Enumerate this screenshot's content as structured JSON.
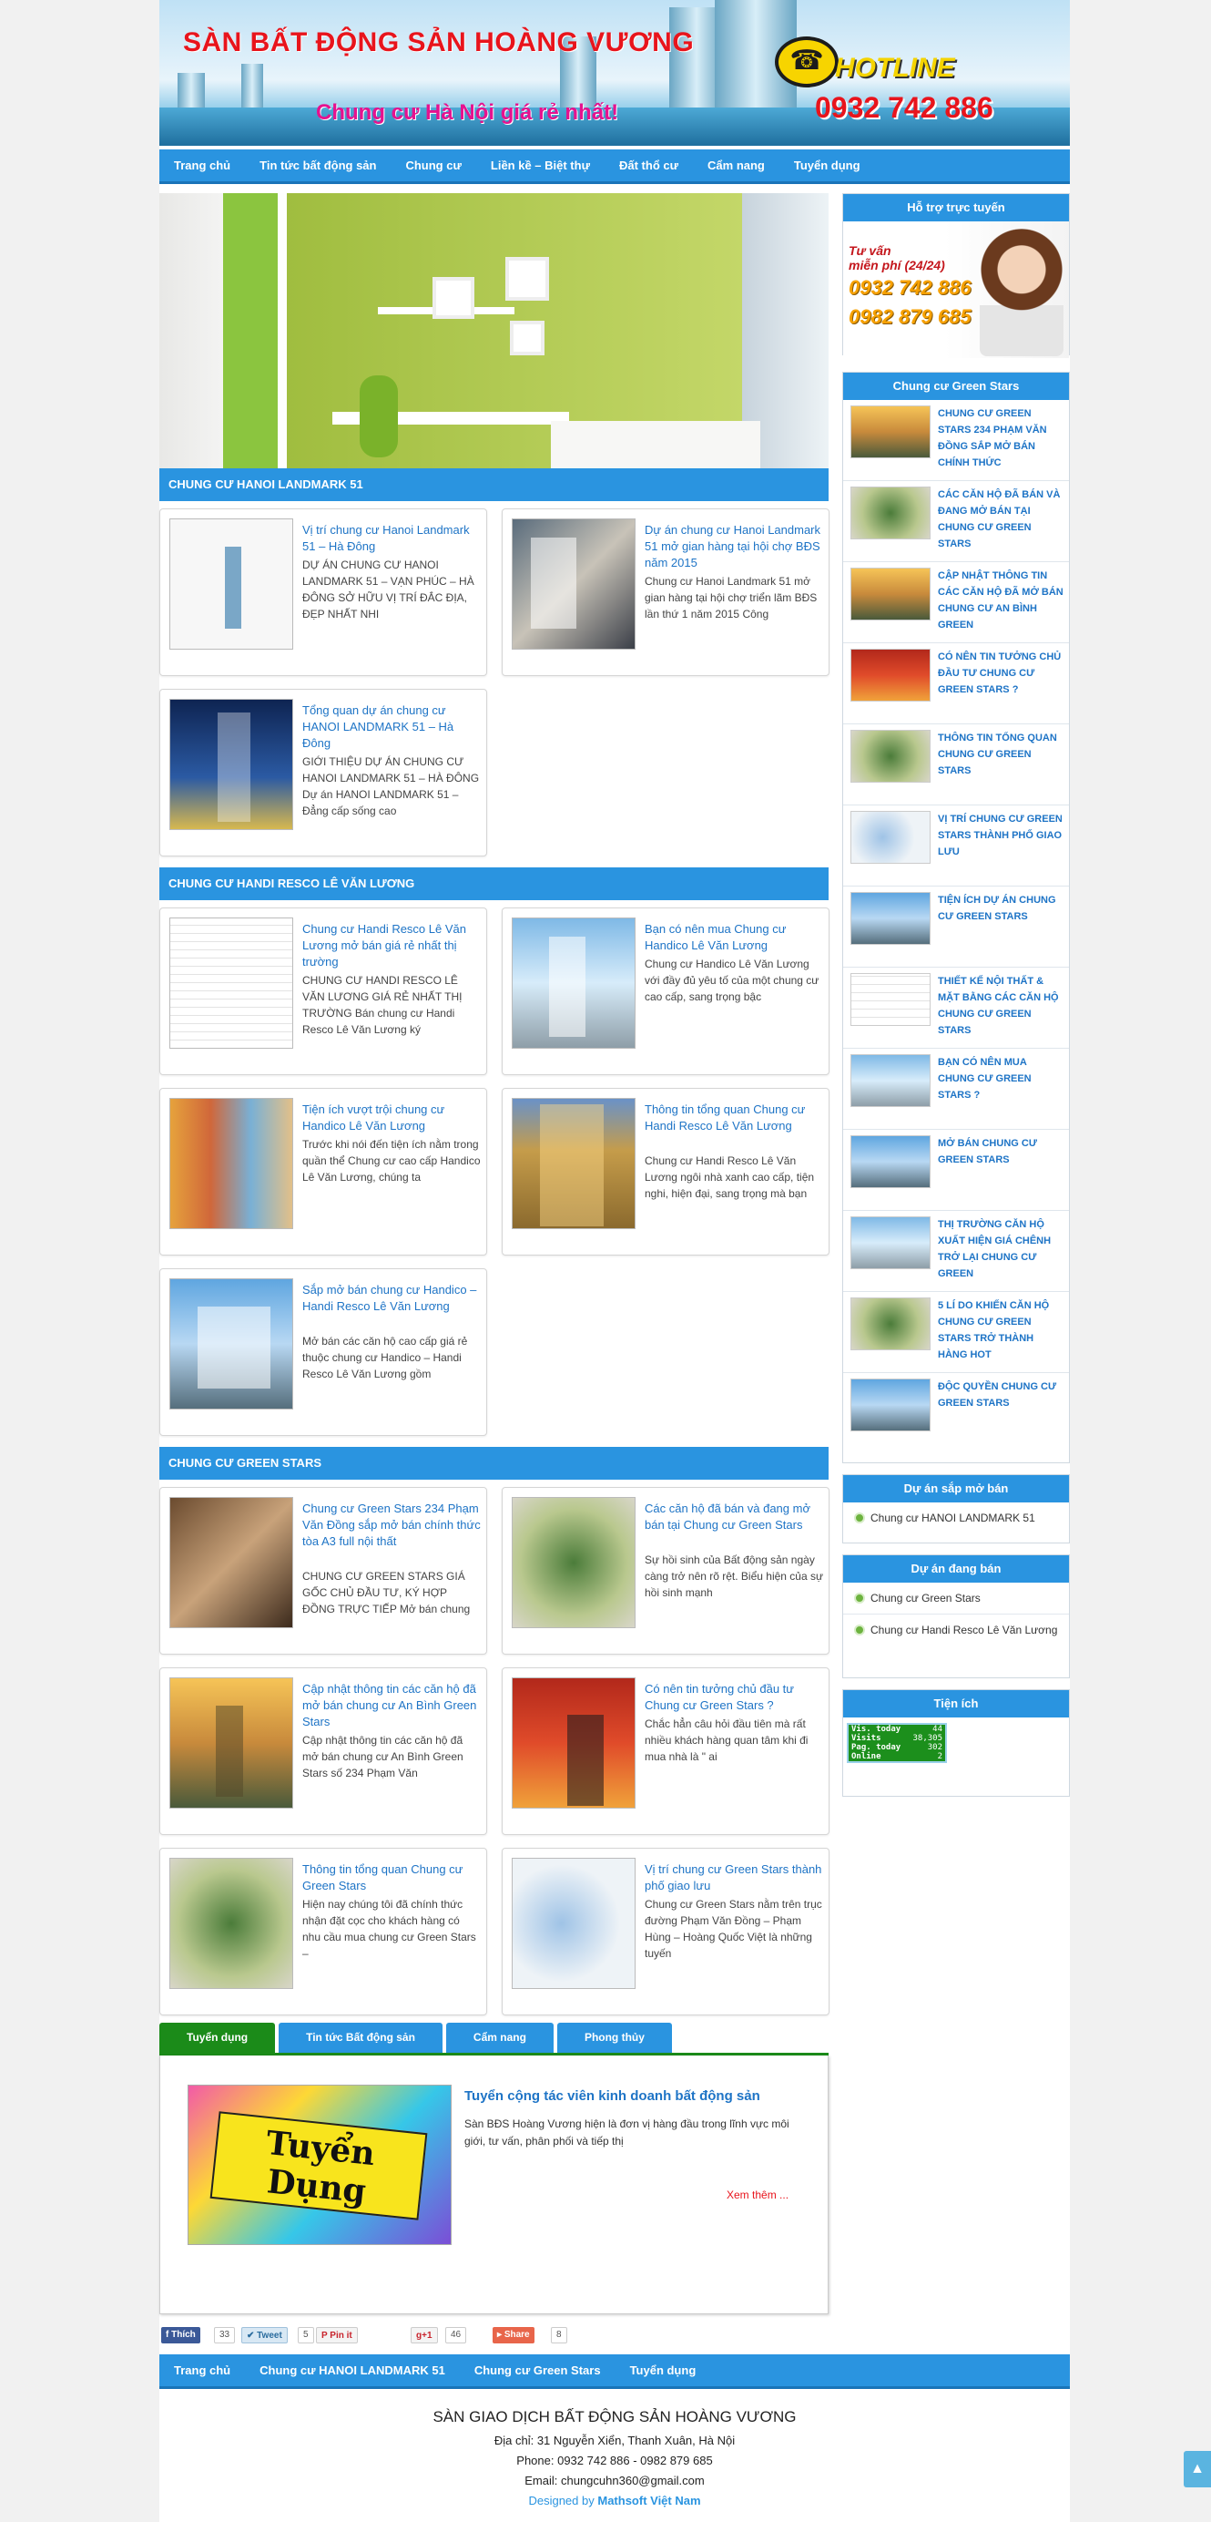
{
  "banner": {
    "site_title": "SÀN BẤT ĐỘNG SẢN HOÀNG VƯƠNG",
    "slogan": "Chung cư Hà Nội giá rẻ nhất!",
    "hotline_label": "HOTLINE",
    "hotline_number": "0932 742 886"
  },
  "top_nav": [
    "Trang chủ",
    "Tin tức bất động sản",
    "Chung cư",
    "Liền kề – Biệt thự",
    "Đất thổ cư",
    "Cẩm nang",
    "Tuyển dụng"
  ],
  "sections": [
    {
      "title": "CHUNG CƯ HANOI LANDMARK 51",
      "posts": [
        {
          "title": "Vị trí chung cư Hanoi Landmark 51 – Hà Đông",
          "desc": "DỰ ÁN CHUNG CƯ HANOI LANDMARK 51 – VẠN PHÚC – HÀ ĐÔNG SỞ HỮU VỊ TRÍ ĐẮC ĐỊA, ĐẸP NHẤT NHI",
          "thumb": "t-map"
        },
        {
          "title": "Dự án chung cư Hanoi Landmark 51 mở gian hàng tại hội chợ BĐS năm 2015",
          "desc": "Chung cư Hanoi Landmark 51 mở gian hàng tại hội chợ triển lãm BĐS lần thứ 1 năm 2015 Công",
          "thumb": "t-expo"
        },
        {
          "title": "Tổng quan dự án chung cư HANOI LANDMARK 51 – Hà Đông",
          "desc": "GIỚI THIỆU DỰ ÁN CHUNG CƯ HANOI LANDMARK 51 – HÀ ĐÔNG Dự án HANOI LANDMARK 51 – Đẳng cấp sống cao",
          "thumb": "t-tower"
        }
      ]
    },
    {
      "title": "CHUNG CƯ HANDI RESCO LÊ VĂN LƯƠNG",
      "posts": [
        {
          "title": "Chung cư Handi Resco Lê Văn Lương mở bán giá rẻ nhất thị trường",
          "desc": "CHUNG CƯ HANDI RESCO LÊ VĂN LƯƠNG GIÁ RẺ NHẤT THỊ TRƯỜNG Bán chung cư Handi Resco Lê Văn Lương ký",
          "thumb": "t-plan"
        },
        {
          "title": "Bạn có nên mua Chung cư Handico Lê Văn Lương",
          "desc": "Chung cư Handico Lê Văn Lương với đầy đủ yêu tố của một chung cư cao cấp, sang trọng bậc",
          "thumb": "t-sky"
        },
        {
          "title": "Tiện ích vượt trội chung cư Handico Lê Văn Lương",
          "desc": "Trước khi nói đến tiện ích nằm trong quần thể Chung cư cao cấp Handico Lê Văn Lương, chúng ta",
          "thumb": "t-collage"
        },
        {
          "title": "Thông tin tổng quan Chung cư Handi Resco Lê Văn Lương",
          "desc": "Chung cư Handi Resco Lê Văn Lương ngôi nhà xanh cao cấp, tiện nghi, hiện đại, sang trọng mà bạn",
          "thumb": "t-gold"
        },
        {
          "title": "Sắp mở bán chung cư Handico – Handi Resco Lê Văn Lương",
          "desc": "Mở bán các căn hộ cao cấp giá rẻ thuộc chung cư Handico – Handi Resco Lê Văn Lương gồm",
          "thumb": "t-render"
        }
      ]
    },
    {
      "title": "CHUNG CƯ GREEN STARS",
      "posts": [
        {
          "title": "Chung cư Green Stars 234 Phạm Văn Đồng sắp mở bán chính thức tòa A3 full nội thất",
          "desc": "CHUNG CƯ GREEN STARS GIÁ GỐC CHỦ ĐẦU TƯ, KÝ HỢP ĐỒNG TRỰC TIẾP Mở bán chung cư Green Stars trong",
          "thumb": "t-room"
        },
        {
          "title": "Các căn hộ đã bán và đang mở bán tại Chung cư Green Stars",
          "desc": "Sự hồi sinh của Bất động sản ngày càng trở nên rõ rệt. Biểu hiện của sự hồi sinh mạnh",
          "thumb": "t-aerial"
        },
        {
          "title": "Cập nhật thông tin các căn hộ đã mở bán chung cư An Bình Green Stars",
          "desc": "Cập nhật thông tin các căn hộ đã mở bán chung cư An Bình Green Stars số 234 Phạm Văn",
          "thumb": "t-sunset"
        },
        {
          "title": "Có nên tin tưởng chủ đầu tư Chung cư Green Stars ?",
          "desc": "Chắc hẳn câu hỏi đầu tiên mà rất nhiều khách hàng quan tâm khi đi mua nhà là \" ai",
          "thumb": "t-speech"
        },
        {
          "title": "Thông tin tổng quan Chung cư Green Stars",
          "desc": " Hiện nay chúng tôi đã chính thức nhận đặt cọc cho khách hàng có nhu cầu mua chung cư Green Stars –",
          "thumb": "t-aerial"
        },
        {
          "title": "Vị trí chung cư Green Stars thành phố giao lưu",
          "desc": "Chung cư Green Stars nằm trên trục đường Phạm Văn Đồng – Phạm Hùng – Hoàng Quốc Việt là những tuyến",
          "thumb": "t-map2"
        }
      ]
    }
  ],
  "tabs": [
    "Tuyển dụng",
    "Tin tức Bất động sản",
    "Cẩm nang",
    "Phong thủy"
  ],
  "tab_content": {
    "image_text": "Tuyển Dụng",
    "title": "Tuyển cộng tác viên kinh doanh bất động sản",
    "desc": "Sàn BĐS Hoàng Vương hiện là đơn vị hàng đầu trong lĩnh vực môi giới, tư vấn, phân phối và tiếp thị",
    "more": "Xem thêm ..."
  },
  "share": {
    "like": "Thích",
    "like_count": "33",
    "tweet": "Tweet",
    "tweet_count": "5",
    "pin": "Pin it",
    "gplus": "+1",
    "gplus_count": "46",
    "share": "Share",
    "share_count": "8"
  },
  "bottom_nav": [
    "Trang chủ",
    "Chung cư HANOI LANDMARK 51",
    "Chung cư Green Stars",
    "Tuyển dụng"
  ],
  "footer": {
    "name": "SÀN GIAO DỊCH BẤT ĐỘNG SẢN HOÀNG VƯƠNG",
    "address": "Địa chỉ: 31 Nguyễn Xiển, Thanh Xuân, Hà Nội",
    "phone": "Phone: 0932 742 886 - 0982 879 685",
    "email": "Email: chungcuhn360@gmail.com",
    "designed_by": "Designed by",
    "designer": "Mathsoft Việt Nam"
  },
  "sidebar": {
    "support": {
      "title": "Hỗ trợ trực tuyến",
      "line1": "Tư vấn",
      "line2": "miễn phí (24/24)",
      "phone1": "0932 742 886",
      "phone2": "0982 879 685"
    },
    "green_stars": {
      "title": "Chung cư Green Stars",
      "items": [
        "Chung cư Green Stars 234 Phạm Văn Đồng sắp mở bán chính thức",
        "Các căn hộ đã bán và đang mở bán tại Chung cư Green Stars",
        "Cập nhật thông tin các căn hộ đã mở bán chung cư An Bình Green",
        "Có nên tin tưởng chủ đầu tư Chung cư Green Stars ?",
        "Thông tin tổng quan Chung cư Green Stars",
        "Vị trí chung cư Green Stars thành phố giao lưu",
        "Tiện ích dự án chung cư Green Stars",
        "Thiết kế nội thất & mặt bằng các căn hộ chung cư Green Stars",
        "Bạn có nên mua chung cư Green Stars ?",
        "Mở bán chung cư Green Stars",
        "Thị trường căn hộ xuất hiện giá chênh trở lại chung cư Green",
        "5 lí do khiến căn hộ chung cư Green Stars trở thành hàng hot",
        "Độc quyền chung cư Green Stars"
      ]
    },
    "upcoming": {
      "title": "Dự án sắp mở bán",
      "items": [
        "Chung cư HANOI LANDMARK 51"
      ]
    },
    "selling": {
      "title": "Dự án đang bán",
      "items": [
        "Chung cư Green Stars",
        "Chung cư Handi Resco Lê Văn Lương"
      ]
    },
    "utility": {
      "title": "Tiện ích",
      "counter": [
        {
          "label": "Vis. today",
          "value": "44"
        },
        {
          "label": "Visits",
          "value": "38,305"
        },
        {
          "label": "Pag. today",
          "value": "302"
        },
        {
          "label": "Online",
          "value": "2"
        }
      ]
    }
  },
  "colors": {
    "nav_blue": "#2a94e0",
    "link_blue": "#1e74c6",
    "tab_green": "#1b8b19",
    "title_red": "#e8141c",
    "slogan_pink": "#e5128f"
  }
}
